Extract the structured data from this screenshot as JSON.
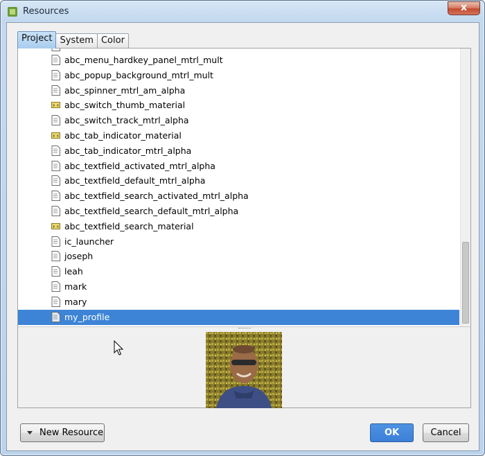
{
  "window": {
    "title": "Resources",
    "close_glyph": "x"
  },
  "tabs": [
    {
      "label": "Project",
      "active": true
    },
    {
      "label": "System",
      "active": false
    },
    {
      "label": "Color",
      "active": false
    }
  ],
  "resource_list": {
    "items": [
      {
        "label": "abc_menu_hardkey_panel_mtrl_mult",
        "icon": "file-icon"
      },
      {
        "label": "abc_popup_background_mtrl_mult",
        "icon": "file-icon"
      },
      {
        "label": "abc_spinner_mtrl_am_alpha",
        "icon": "file-icon"
      },
      {
        "label": "abc_switch_thumb_material",
        "icon": "xml-drawable-icon"
      },
      {
        "label": "abc_switch_track_mtrl_alpha",
        "icon": "file-icon"
      },
      {
        "label": "abc_tab_indicator_material",
        "icon": "xml-drawable-icon"
      },
      {
        "label": "abc_tab_indicator_mtrl_alpha",
        "icon": "file-icon"
      },
      {
        "label": "abc_textfield_activated_mtrl_alpha",
        "icon": "file-icon"
      },
      {
        "label": "abc_textfield_default_mtrl_alpha",
        "icon": "file-icon"
      },
      {
        "label": "abc_textfield_search_activated_mtrl_alpha",
        "icon": "file-icon"
      },
      {
        "label": "abc_textfield_search_default_mtrl_alpha",
        "icon": "file-icon"
      },
      {
        "label": "abc_textfield_search_material",
        "icon": "xml-drawable-icon"
      },
      {
        "label": "ic_launcher",
        "icon": "file-icon"
      },
      {
        "label": "joseph",
        "icon": "file-icon"
      },
      {
        "label": "leah",
        "icon": "file-icon"
      },
      {
        "label": "mark",
        "icon": "file-icon"
      },
      {
        "label": "mary",
        "icon": "file-icon"
      },
      {
        "label": "my_profile",
        "icon": "file-icon",
        "selected": true
      }
    ]
  },
  "preview": {
    "icon": "profile-photo-preview"
  },
  "buttons": {
    "new_resource": "New Resource",
    "ok": "OK",
    "cancel": "Cancel"
  },
  "colors": {
    "selection": "#3e84d6",
    "ok_button": "#3b7fd8",
    "title_bar": "#c4d9ef"
  }
}
